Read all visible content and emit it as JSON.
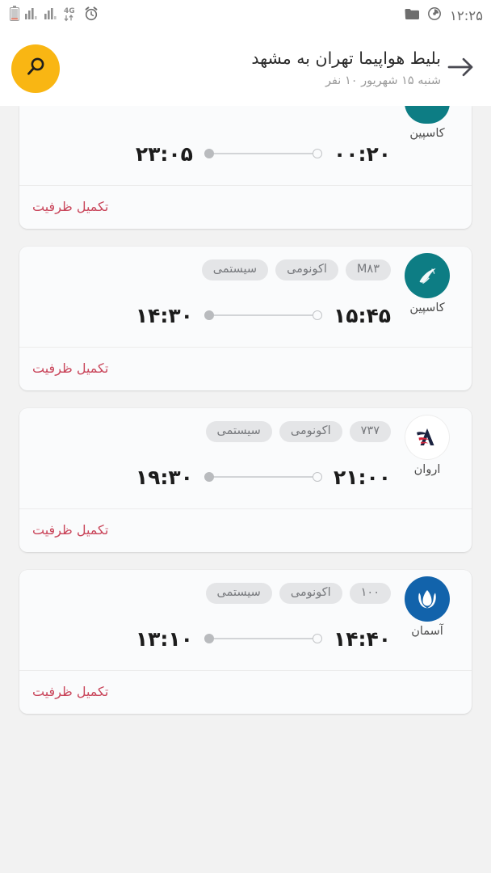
{
  "statusbar": {
    "time": "۱۲:۲۵",
    "left_icons": [
      "battery-icon",
      "signal-bars-icon",
      "signal-bars-icon",
      "4g-data-icon",
      "alarm-clock-icon"
    ],
    "right_icons": [
      "folder-icon",
      "screen-record-icon"
    ],
    "network_label": "4G"
  },
  "appbar": {
    "title": "بلیط هواپیما تهران به مشهد",
    "subtitle": "شنبه ۱۵ شهریور ۱۰ نفر",
    "search_icon": "search-icon",
    "back_icon": "arrow-back-icon"
  },
  "flights": [
    {
      "airline": "کاسپین",
      "logo": "caspian-logo",
      "logo_color": "#0d7d84",
      "tags": [],
      "arrival_time": "۰۰:۲۰",
      "departure_time": "۲۳:۰۵",
      "status": "تکمیل ظرفیت",
      "partial": true
    },
    {
      "airline": "کاسپین",
      "logo": "caspian-logo",
      "logo_color": "#0d7d84",
      "tags": [
        "M۸۳",
        "اکونومی",
        "سیستمی"
      ],
      "arrival_time": "۱۵:۴۵",
      "departure_time": "۱۴:۳۰",
      "status": "تکمیل ظرفیت",
      "partial": false
    },
    {
      "airline": "اروان",
      "logo": "arvan-logo",
      "logo_color": "#ffffff",
      "tags": [
        "۷۳۷",
        "اکونومی",
        "سیستمی"
      ],
      "arrival_time": "۲۱:۰۰",
      "departure_time": "۱۹:۳۰",
      "status": "تکمیل ظرفیت",
      "partial": false
    },
    {
      "airline": "آسمان",
      "logo": "aseman-logo",
      "logo_color": "#1263ab",
      "tags": [
        "۱۰۰",
        "اکونومی",
        "سیستمی"
      ],
      "arrival_time": "۱۴:۴۰",
      "departure_time": "۱۳:۱۰",
      "status": "تکمیل ظرفیت",
      "partial": false
    }
  ],
  "colors": {
    "accent": "#f9b613",
    "soldout": "#c9455a",
    "page_bg": "#f2f2f2",
    "card_bg": "#fafbfc"
  }
}
